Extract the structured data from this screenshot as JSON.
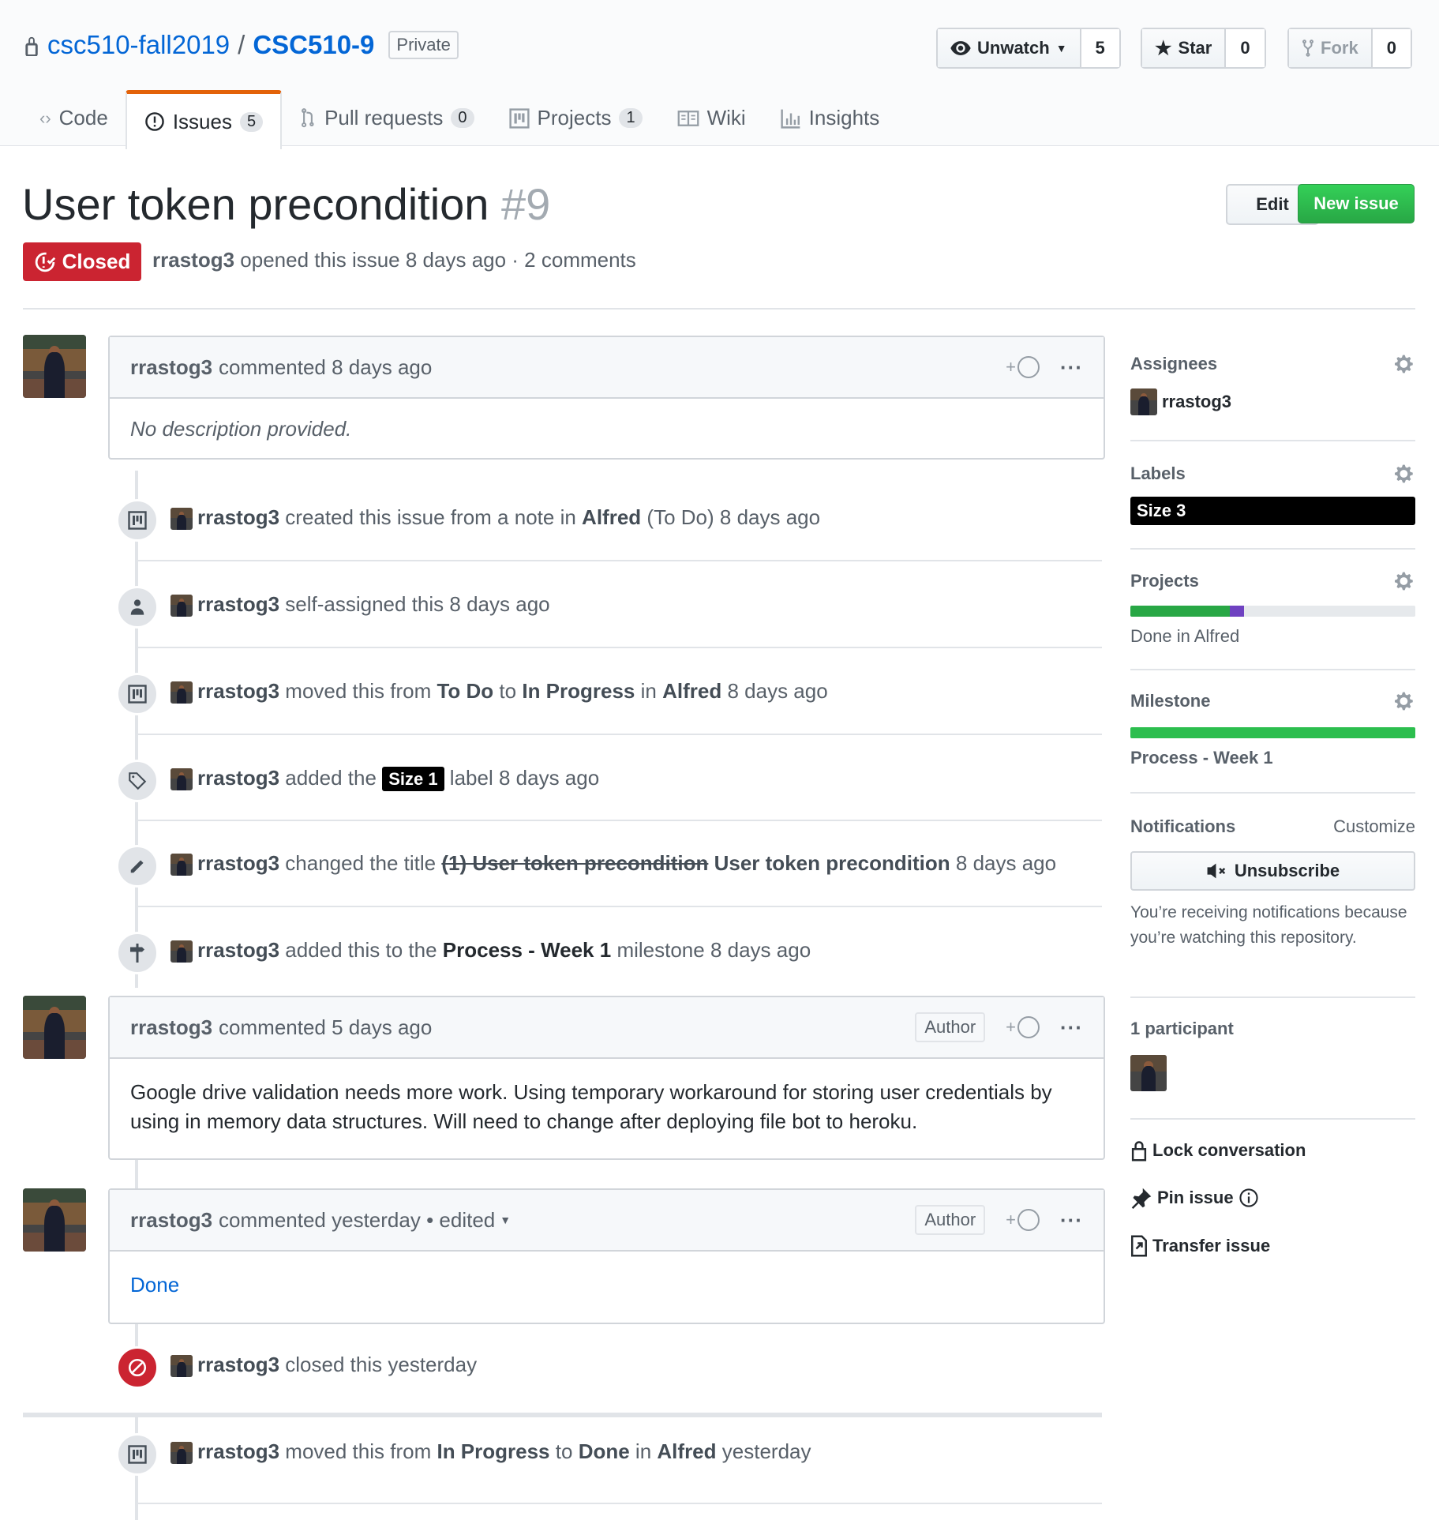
{
  "repo": {
    "owner": "csc510-fall2019",
    "name": "CSC510-9",
    "visibility": "Private"
  },
  "actions": {
    "watch": {
      "label": "Unwatch",
      "count": "5"
    },
    "star": {
      "label": "Star",
      "count": "0"
    },
    "fork": {
      "label": "Fork",
      "count": "0"
    }
  },
  "tabs": [
    {
      "label": "Code"
    },
    {
      "label": "Issues",
      "count": "5"
    },
    {
      "label": "Pull requests",
      "count": "0"
    },
    {
      "label": "Projects",
      "count": "1"
    },
    {
      "label": "Wiki"
    },
    {
      "label": "Insights"
    }
  ],
  "issue": {
    "title": "User token precondition",
    "number": "#9",
    "state": "Closed",
    "author": "rrastog3",
    "meta": "opened this issue 8 days ago · 2 comments",
    "edit_label": "Edit",
    "new_issue_label": "New issue"
  },
  "comments": [
    {
      "author": "rrastog3",
      "action": "commented",
      "time": "8 days ago",
      "body": "No description provided."
    },
    {
      "author": "rrastog3",
      "action": "commented",
      "time": "5 days ago",
      "badge": "Author",
      "body": "Google drive validation needs more work. Using temporary workaround for storing user credentials by using in memory data structures. Will need to change after deploying file bot to heroku."
    },
    {
      "author": "rrastog3",
      "action": "commented",
      "time": "yesterday",
      "edited": "• edited",
      "badge": "Author",
      "body": "Done"
    }
  ],
  "events": {
    "e1": {
      "user": "rrastog3",
      "t1": "created this issue from a note in",
      "project": "Alfred",
      "col": "(To Do)",
      "time": "8 days ago"
    },
    "e2": {
      "user": "rrastog3",
      "t1": "self-assigned this",
      "time": "8 days ago"
    },
    "e3": {
      "user": "rrastog3",
      "t1": "moved this from",
      "from": "To Do",
      "to_word": "to",
      "to": "In Progress",
      "in_word": "in",
      "project": "Alfred",
      "time": "8 days ago"
    },
    "e4": {
      "user": "rrastog3",
      "t1": "added the",
      "label": "Size 1",
      "t2": "label",
      "time": "8 days ago"
    },
    "e5": {
      "user": "rrastog3",
      "t1": "changed the title",
      "old": "(1) User token precondition",
      "new": "User token precondition",
      "time": "8 days ago"
    },
    "e6": {
      "user": "rrastog3",
      "t1": "added this to the",
      "milestone": "Process - Week 1",
      "t2": "milestone",
      "time": "8 days ago"
    },
    "e7": {
      "user": "rrastog3",
      "t1": "closed this",
      "time": "yesterday"
    },
    "e8": {
      "user": "rrastog3",
      "t1": "moved this from",
      "from": "In Progress",
      "to_word": "to",
      "to": "Done",
      "in_word": "in",
      "project": "Alfred",
      "time": "yesterday"
    }
  },
  "sidebar": {
    "assignees": {
      "heading": "Assignees",
      "user": "rrastog3"
    },
    "labels": {
      "heading": "Labels",
      "label": "Size 3"
    },
    "projects": {
      "heading": "Projects",
      "status": "Done in Alfred",
      "progress": {
        "done": 0.35,
        "in_progress": 0.05
      }
    },
    "milestone": {
      "heading": "Milestone",
      "title": "Process - Week 1",
      "progress": 1.0
    },
    "notifications": {
      "heading": "Notifications",
      "customize": "Customize",
      "button": "Unsubscribe",
      "reason": "You’re receiving notifications because you’re watching this repository."
    },
    "participants": {
      "heading": "1 participant"
    },
    "lock": "Lock conversation",
    "pin": "Pin issue",
    "transfer": "Transfer issue"
  },
  "colors": {
    "closed": "#cb2431",
    "green": "#28a745",
    "link": "#0366d6",
    "purple": "#6f42c1"
  }
}
